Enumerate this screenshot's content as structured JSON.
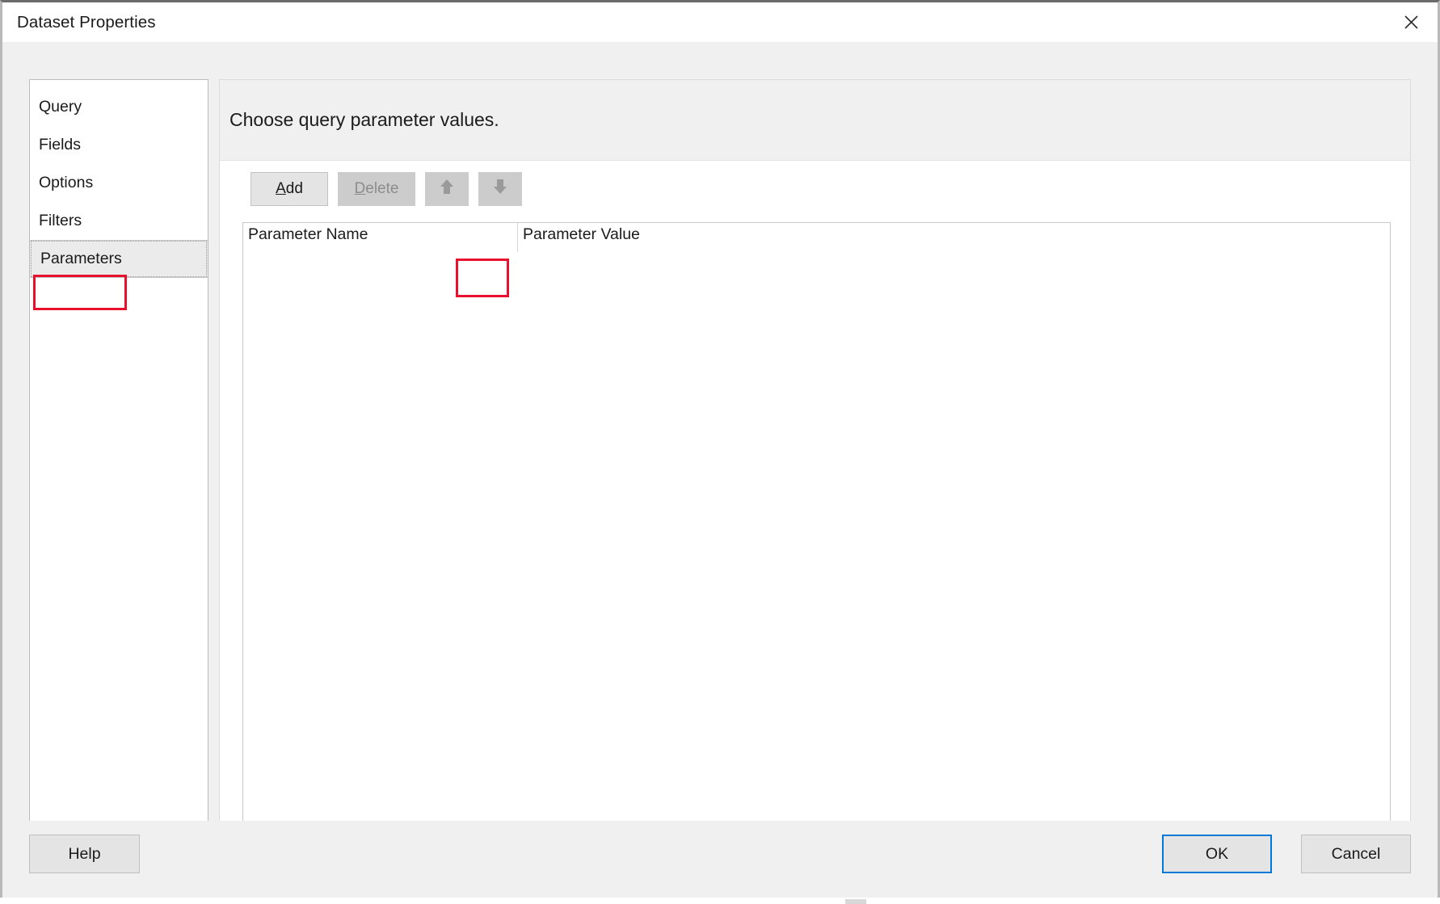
{
  "window": {
    "title": "Dataset Properties",
    "close_icon": "close-icon"
  },
  "sidebar": {
    "items": [
      {
        "label": "Query",
        "selected": false
      },
      {
        "label": "Fields",
        "selected": false
      },
      {
        "label": "Options",
        "selected": false
      },
      {
        "label": "Filters",
        "selected": false
      },
      {
        "label": "Parameters",
        "selected": true
      }
    ]
  },
  "content": {
    "heading": "Choose query parameter values.",
    "toolbar": {
      "add": {
        "label": "Add",
        "mnemonic": "A",
        "rest": "dd",
        "enabled": true
      },
      "delete": {
        "label": "Delete",
        "mnemonic": "D",
        "rest": "elete",
        "enabled": false
      },
      "move_up": {
        "icon": "arrow-up-icon",
        "enabled": false
      },
      "move_down": {
        "icon": "arrow-down-icon",
        "enabled": false
      }
    },
    "grid": {
      "columns": [
        "Parameter Name",
        "Parameter Value"
      ],
      "rows": []
    }
  },
  "footer": {
    "help": "Help",
    "ok": "OK",
    "cancel": "Cancel"
  },
  "annotations": {
    "accent_color": "#e8112d",
    "highlighted": [
      "Parameters",
      "Add"
    ]
  }
}
